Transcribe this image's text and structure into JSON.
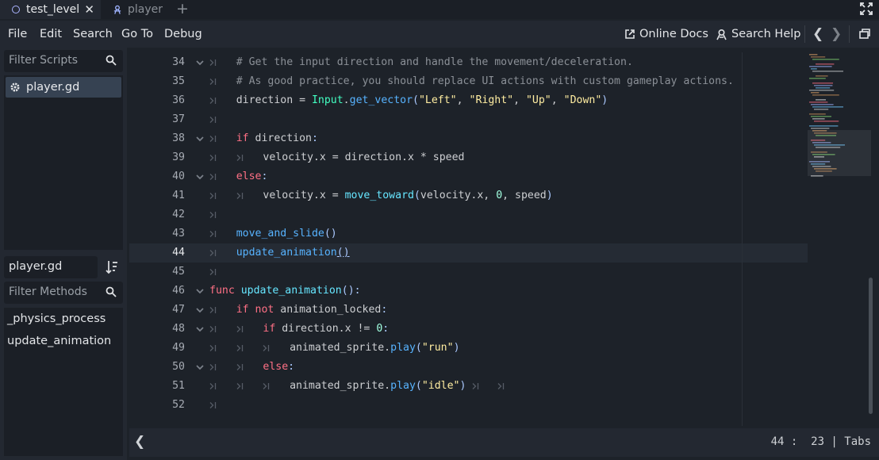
{
  "tabs": [
    {
      "label": "test_level",
      "active": true,
      "icon": "node3d-ring-icon"
    },
    {
      "label": "player",
      "active": false,
      "icon": "character-icon"
    }
  ],
  "menu": {
    "items": [
      "File",
      "Edit",
      "Search",
      "Go To",
      "Debug"
    ],
    "online_docs": "Online Docs",
    "search_help": "Search Help"
  },
  "sidebar": {
    "filter_scripts_placeholder": "Filter Scripts",
    "scripts": [
      {
        "label": "player.gd",
        "icon": "gear-icon",
        "selected": true
      }
    ],
    "current_script": "player.gd",
    "filter_methods_placeholder": "Filter Methods",
    "methods": [
      "_physics_process",
      "update_animation"
    ]
  },
  "editor": {
    "current_line": 44,
    "lines": [
      {
        "num": "34",
        "text": "# Get the input direction and handle the movement/deceleration."
      },
      {
        "num": "35",
        "text": "# As good practice, you should replace UI actions with custom gameplay actions."
      },
      {
        "num": "36",
        "text": "direction = Input.get_vector(\"Left\", \"Right\", \"Up\", \"Down\")"
      },
      {
        "num": "37",
        "text": ""
      },
      {
        "num": "38",
        "text": "if direction:"
      },
      {
        "num": "39",
        "text": "velocity.x = direction.x * speed"
      },
      {
        "num": "40",
        "text": "else:"
      },
      {
        "num": "41",
        "text": "velocity.x = move_toward(velocity.x, 0, speed)"
      },
      {
        "num": "42",
        "text": ""
      },
      {
        "num": "43",
        "text": "move_and_slide()"
      },
      {
        "num": "44",
        "text": "update_animation()"
      },
      {
        "num": "45",
        "text": ""
      },
      {
        "num": "46",
        "text": "func update_animation():"
      },
      {
        "num": "47",
        "text": "if not animation_locked:"
      },
      {
        "num": "48",
        "text": "if direction.x != 0:"
      },
      {
        "num": "49",
        "text": "animated_sprite.play(\"run\")"
      },
      {
        "num": "50",
        "text": "else:"
      },
      {
        "num": "51",
        "text": "animated_sprite.play(\"idle\")"
      },
      {
        "num": "52",
        "text": ""
      }
    ]
  },
  "status": {
    "cursor_line": "44",
    "cursor_col": "23",
    "indent_mode": "Tabs",
    "text": "44 :  23 | Tabs"
  },
  "colors": {
    "background": "#1d2229",
    "panel": "#232831",
    "keyword": "#ff7085",
    "function": "#57b3ff",
    "string": "#ffeda1",
    "number": "#a1ffe0",
    "comment": "#8b9097",
    "class": "#42ffc2"
  }
}
